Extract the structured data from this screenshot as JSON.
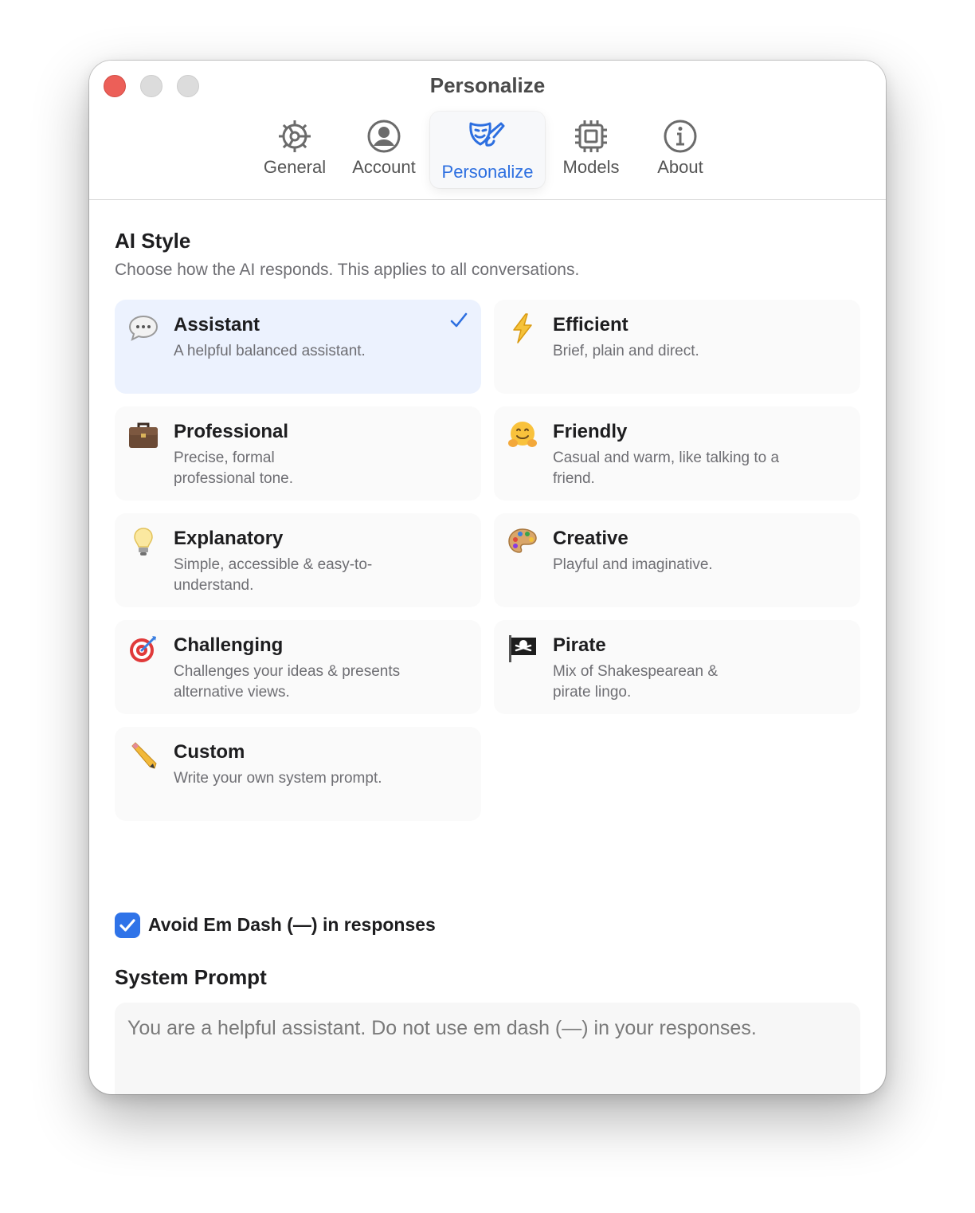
{
  "window": {
    "title": "Personalize"
  },
  "tabs": [
    {
      "label": "General",
      "icon": "gear-icon"
    },
    {
      "label": "Account",
      "icon": "person-circle-icon"
    },
    {
      "label": "Personalize",
      "icon": "theater-masks-icon",
      "active": true
    },
    {
      "label": "Models",
      "icon": "cpu-chip-icon"
    },
    {
      "label": "About",
      "icon": "info-circle-icon"
    }
  ],
  "ai_style": {
    "title": "AI Style",
    "subtitle": "Choose how the AI responds. This applies to all conversations.",
    "styles": [
      {
        "title": "Assistant",
        "desc": "A helpful balanced assistant.",
        "icon": "speech-bubble-icon",
        "selected": true
      },
      {
        "title": "Efficient",
        "desc": "Brief, plain and direct.",
        "icon": "lightning-icon"
      },
      {
        "title": "Professional",
        "desc": "Precise, formal professional tone.",
        "icon": "briefcase-icon"
      },
      {
        "title": "Friendly",
        "desc": "Casual and warm, like talking to a friend.",
        "icon": "hugging-face-icon"
      },
      {
        "title": "Explanatory",
        "desc": "Simple, accessible & easy-to-understand.",
        "icon": "lightbulb-icon"
      },
      {
        "title": "Creative",
        "desc": "Playful and imaginative.",
        "icon": "palette-icon"
      },
      {
        "title": "Challenging",
        "desc": "Challenges your ideas & presents alternative views.",
        "icon": "target-dart-icon"
      },
      {
        "title": "Pirate",
        "desc": "Mix of Shakespearean & pirate lingo.",
        "icon": "pirate-flag-icon"
      },
      {
        "title": "Custom",
        "desc": "Write your own system prompt.",
        "icon": "pencil-icon"
      }
    ]
  },
  "avoid_em_dash": {
    "label": "Avoid Em Dash (—) in responses",
    "checked": true
  },
  "system_prompt": {
    "title": "System Prompt",
    "value": "You are a helpful assistant. Do not use em dash (—) in your responses."
  },
  "colors": {
    "accent": "#2f73e8",
    "close_button": "#ec5f58",
    "selected_card": "#ecf2fe"
  }
}
